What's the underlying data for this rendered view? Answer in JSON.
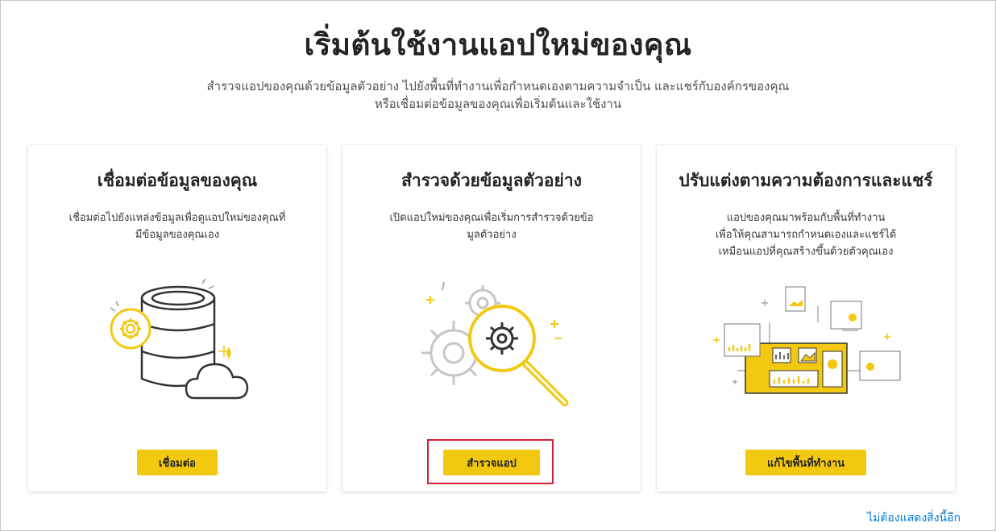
{
  "page": {
    "title": "เริ่มต้นใช้งานแอปใหม่ของคุณ",
    "subtitle_line1": "สำรวจแอปของคุณด้วยข้อมูลตัวอย่าง ไปยังพื้นที่ทำงานเพื่อกำหนดเองตามความจำเป็น และแชร์กับองค์กรของคุณ",
    "subtitle_line2": "หรือเชื่อมต่อข้อมูลของคุณเพื่อเริ่มต้นและใช้งาน"
  },
  "cards": [
    {
      "title": "เชื่อมต่อข้อมูลของคุณ",
      "desc_line1": "เชื่อมต่อไปยังแหล่งข้อมูลเพื่อดูแอปใหม่ของคุณที่",
      "desc_line2": "มีข้อมูลของคุณเอง",
      "desc_line3": "",
      "button_label": "เชื่อมต่อ",
      "icon": "database-cloud-icon"
    },
    {
      "title": "สำรวจด้วยข้อมูลตัวอย่าง",
      "desc_line1": "เปิดแอปใหม่ของคุณเพื่อเริ่มการสำรวจด้วยข้อ",
      "desc_line2": "มูลตัวอย่าง",
      "desc_line3": "",
      "button_label": "สำรวจแอป",
      "icon": "gears-magnifier-icon"
    },
    {
      "title": "ปรับแต่งตามความต้องการและแชร์",
      "desc_line1": "แอปของคุณมาพร้อมกับพื้นที่ทำงาน",
      "desc_line2": "เพื่อให้คุณสามารถกำหนดเองและแชร์ได้",
      "desc_line3": "เหมือนแอปที่คุณสร้างขึ้นด้วยตัวคุณเอง",
      "button_label": "แก้ไขพื้นที่ทำงาน",
      "icon": "dashboard-workspace-icon"
    }
  ],
  "footer": {
    "dont_show_label": "ไม่ต้องแสดงสิ่งนี้อีก"
  },
  "colors": {
    "accent": "#f2c811",
    "highlight": "#d32035",
    "link": "#0078d4"
  }
}
